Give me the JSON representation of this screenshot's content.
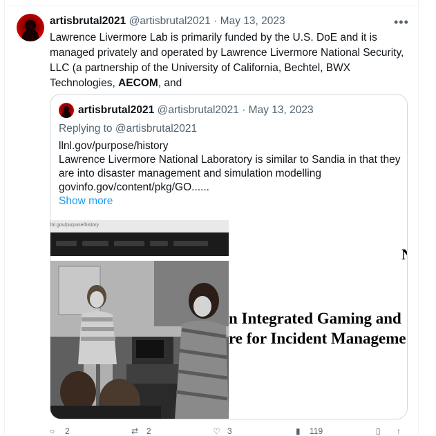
{
  "tweet": {
    "author_name": "artisbrutal2021",
    "author_handle": "@artisbrutal2021",
    "separator": "·",
    "date": "May 13, 2023",
    "more_icon": "more-horizontal-icon",
    "text_before_bold": "Lawrence Livermore Lab is primarily funded by the U.S. DoE and it is managed privately and operated by Lawrence Livermore National Security, LLC (a partnership of the University of California, Bechtel, BWX Technologies, ",
    "text_bold": "AECOM",
    "text_after_bold": ", and"
  },
  "quote": {
    "author_name": "artisbrutal2021",
    "author_handle": "@artisbrutal2021",
    "separator": "·",
    "date": "May 13, 2023",
    "replying_to": "Replying to @artisbrutal2021",
    "lines": [
      "llnl.gov/purpose/history",
      "Lawrence Livermore National Laboratory is similar to Sandia in that they are into disaster management and simulation modelling",
      "govinfo.gov/content/pkg/GO......"
    ],
    "show_more": "Show more",
    "media": {
      "left_url_text": "lnl.gov/purpose/history",
      "right_letter": "N",
      "right_line1": "n Integrated Gaming and",
      "right_line2": "re for Incident Manageme"
    }
  },
  "actions": {
    "reply_icon": "reply-icon",
    "reply_count": "2",
    "retweet_icon": "retweet-icon",
    "retweet_count": "2",
    "like_icon": "heart-icon",
    "like_count": "3",
    "views_icon": "views-icon",
    "views_count": "119",
    "bookmark_icon": "bookmark-icon",
    "share_icon": "share-icon"
  }
}
